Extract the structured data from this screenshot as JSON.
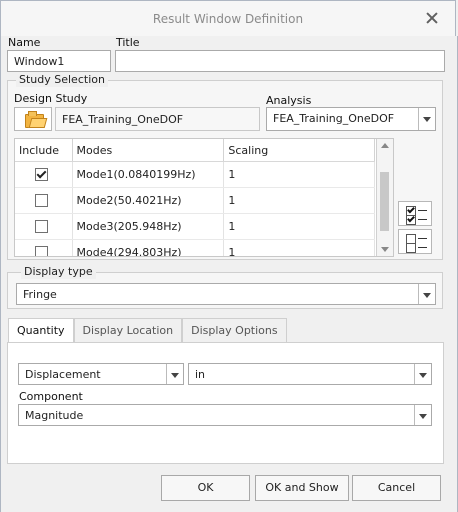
{
  "window": {
    "title": "Result Window Definition"
  },
  "fields": {
    "name_label": "Name",
    "name_value": "Window1",
    "title_label": "Title",
    "title_value": ""
  },
  "study": {
    "group_label": "Study Selection",
    "design_study_label": "Design Study",
    "design_study_value": "FEA_Training_OneDOF",
    "analysis_label": "Analysis",
    "analysis_value": "FEA_Training_OneDOF"
  },
  "table": {
    "headers": [
      "Include",
      "Modes",
      "Scaling"
    ],
    "rows": [
      {
        "include": true,
        "mode": "Mode1(0.0840199Hz)",
        "scaling": "1"
      },
      {
        "include": false,
        "mode": "Mode2(50.4021Hz)",
        "scaling": "1"
      },
      {
        "include": false,
        "mode": "Mode3(205.948Hz)",
        "scaling": "1"
      },
      {
        "include": false,
        "mode": "Mode4(294.803Hz)",
        "scaling": "1"
      }
    ]
  },
  "display": {
    "type_label": "Display type",
    "type_value": "Fringe"
  },
  "tabs": [
    "Quantity",
    "Display Location",
    "Display Options"
  ],
  "quantity": {
    "measure": "Displacement",
    "units": "in",
    "component_label": "Component",
    "component_value": "Magnitude"
  },
  "buttons": {
    "ok": "OK",
    "ok_show": "OK and Show",
    "cancel": "Cancel"
  }
}
